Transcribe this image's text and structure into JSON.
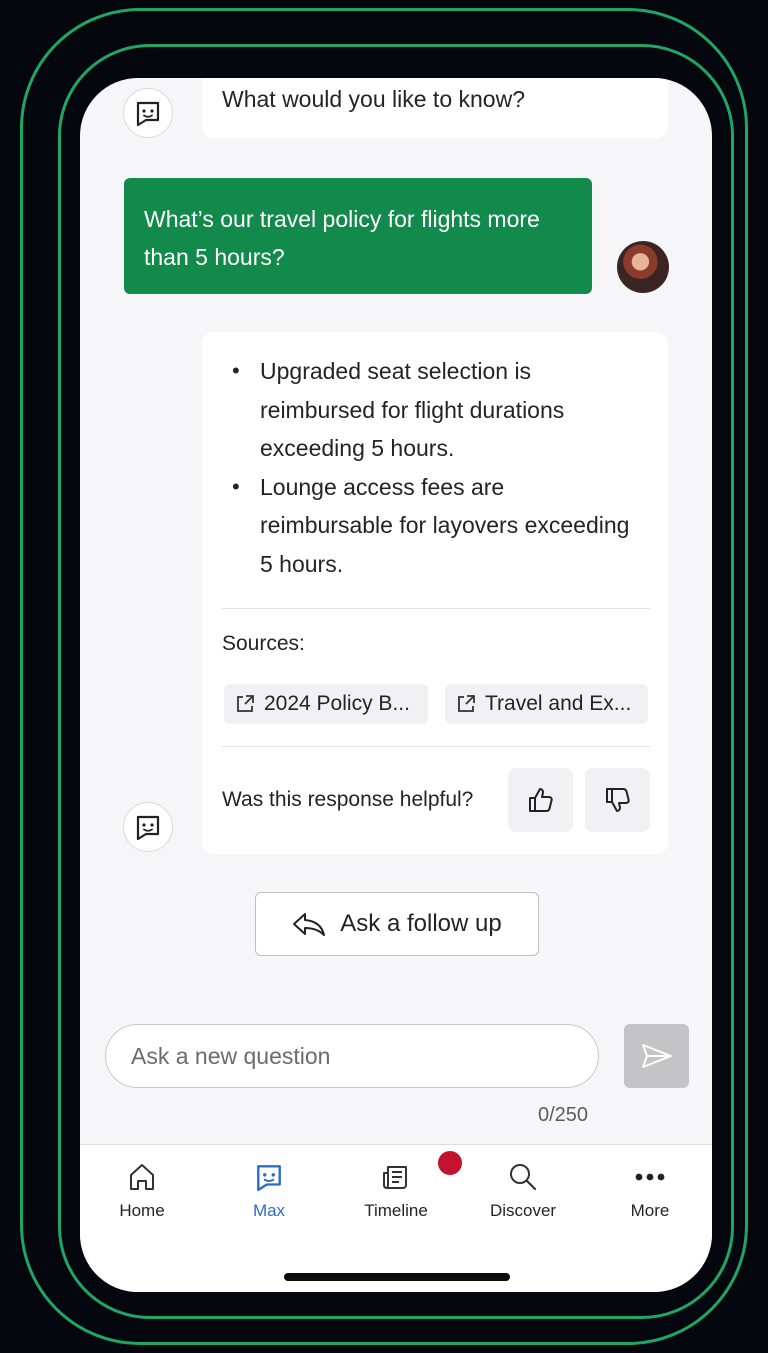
{
  "chat": {
    "bot_greeting": "What would you like to know?",
    "user_question": "What’s our travel policy for flights more than 5 hours?",
    "answer_points": [
      "Upgraded seat selection is reimbursed for flight durations exceeding 5 hours.",
      "Lounge access fees are reimbursable for layovers exceeding 5 hours."
    ],
    "sources_label": "Sources:",
    "sources": [
      "2024 Policy B...",
      "Travel and Ex..."
    ],
    "helpful_prompt": "Was this response helpful?"
  },
  "follow_up_label": "Ask a follow up",
  "input": {
    "placeholder": "Ask a new question",
    "counter": "0/250"
  },
  "nav": [
    {
      "label": "Home",
      "icon": "home-icon"
    },
    {
      "label": "Max",
      "icon": "bot-face-icon",
      "active": true
    },
    {
      "label": "Timeline",
      "icon": "news-icon",
      "badge": true
    },
    {
      "label": "Discover",
      "icon": "search-icon"
    },
    {
      "label": "More",
      "icon": "more-icon"
    }
  ],
  "colors": {
    "accent_green": "#128a4b",
    "active_blue": "#2b6cc4",
    "badge_red": "#c4132c",
    "frame_green": "#1fa565"
  }
}
